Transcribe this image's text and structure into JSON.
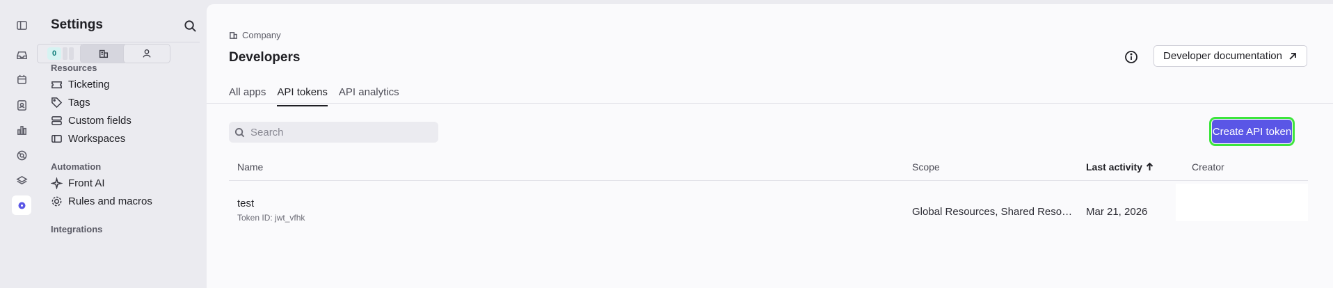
{
  "sidebar": {
    "title": "Settings",
    "segments": {
      "toggle_badge": "0"
    },
    "sections": [
      {
        "label": "Resources",
        "items": [
          "Ticketing",
          "Tags",
          "Custom fields",
          "Workspaces"
        ]
      },
      {
        "label": "Automation",
        "items": [
          "Front AI",
          "Rules and macros"
        ]
      },
      {
        "label": "Integrations",
        "items": []
      }
    ]
  },
  "rail_icons": [
    "sidebar-toggle-icon",
    "inbox-icon",
    "calendar-icon",
    "contacts-icon",
    "analytics-icon",
    "help-icon",
    "layers-icon",
    "settings-icon"
  ],
  "main": {
    "breadcrumb": "Company",
    "title": "Developers",
    "doc_button": "Developer documentation",
    "tabs": [
      "All apps",
      "API tokens",
      "API analytics"
    ],
    "active_tab": "API tokens",
    "search_placeholder": "Search",
    "create_button": "Create API token",
    "table": {
      "columns": [
        "Name",
        "Scope",
        "Last activity",
        "Creator"
      ],
      "sorted_column": "Last activity",
      "rows": [
        {
          "name": "test",
          "token_id": "Token ID: jwt_vfhk",
          "scope": "Global Resources, Shared Resources",
          "last_activity": "Mar 21, 2026",
          "creator": ""
        }
      ]
    }
  },
  "colors": {
    "accent": "#5a56e6",
    "highlight": "#3ce53c",
    "badge_bg": "#d6f3f2"
  }
}
